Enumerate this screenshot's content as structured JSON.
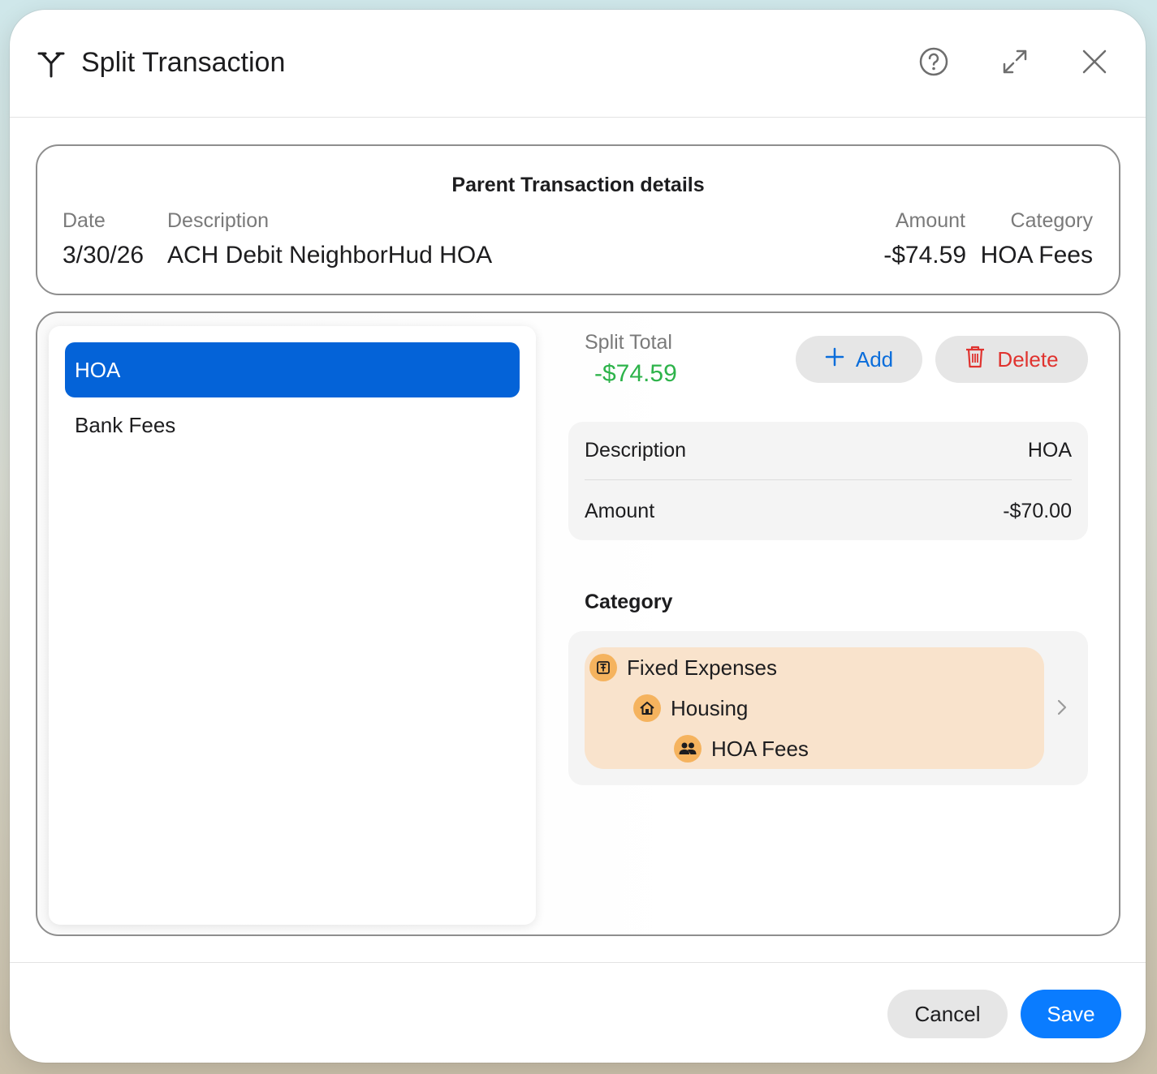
{
  "window": {
    "title": "Split Transaction",
    "icons": {
      "title": "split-icon",
      "help": "question-circle-icon",
      "expand": "expand-arrows-icon",
      "close": "close-x-icon"
    }
  },
  "parent": {
    "heading": "Parent Transaction details",
    "labels": {
      "date": "Date",
      "description": "Description",
      "amount": "Amount",
      "category": "Category"
    },
    "values": {
      "date": "3/30/26",
      "description": "ACH Debit NeighborHud HOA",
      "amount": "-$74.59",
      "category": "HOA Fees"
    }
  },
  "splits": {
    "items": [
      {
        "label": "HOA",
        "selected": true
      },
      {
        "label": "Bank Fees",
        "selected": false
      }
    ]
  },
  "split_total": {
    "label": "Split Total",
    "value": "-$74.59"
  },
  "actions": {
    "add": "Add",
    "delete": "Delete"
  },
  "detail": {
    "description_label": "Description",
    "description_value": "HOA",
    "amount_label": "Amount",
    "amount_value": "-$70.00"
  },
  "category": {
    "heading": "Category",
    "path": [
      {
        "label": "Fixed Expenses",
        "icon": "pushpin-icon"
      },
      {
        "label": "Housing",
        "icon": "house-icon"
      },
      {
        "label": "HOA Fees",
        "icon": "people-icon"
      }
    ]
  },
  "footer": {
    "cancel": "Cancel",
    "save": "Save"
  },
  "colors": {
    "accent": "#0a7cff",
    "selected": "#0463d8",
    "positive": "#2db34a",
    "danger": "#e0332f",
    "category_bg": "#f9e3cc",
    "category_icon": "#f5b35e"
  }
}
